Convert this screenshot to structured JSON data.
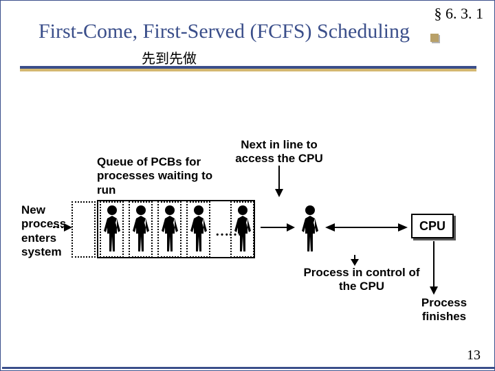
{
  "section_ref": "§ 6. 3. 1",
  "title": "First-Come, First-Served (FCFS) Scheduling",
  "subtitle": "先到先做",
  "labels": {
    "queue": "Queue of PCBs for processes waiting to run",
    "next": "Next in line to access the CPU",
    "new": "New process enters system",
    "control": "Process in control of the CPU",
    "finishes": "Process finishes",
    "cpu": "CPU"
  },
  "page_number": "13"
}
